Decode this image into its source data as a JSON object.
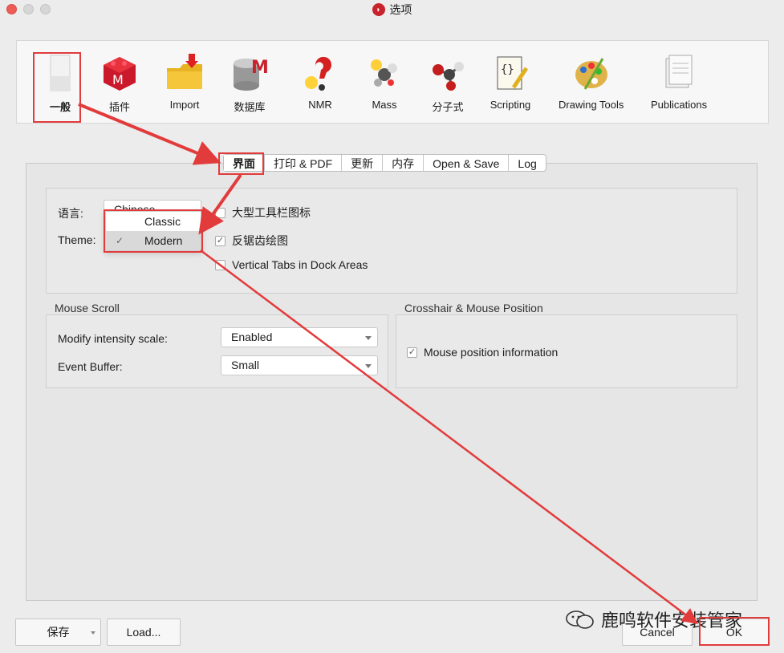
{
  "window": {
    "title": "选项"
  },
  "toolbar": {
    "items": [
      {
        "label": "一般",
        "icon": "general-settings-icon"
      },
      {
        "label": "插件",
        "icon": "plugins-icon"
      },
      {
        "label": "Import",
        "icon": "import-folder-icon"
      },
      {
        "label": "数据库",
        "icon": "database-icon"
      },
      {
        "label": "NMR",
        "icon": "nmr-icon"
      },
      {
        "label": "Mass",
        "icon": "mass-spec-icon"
      },
      {
        "label": "分子式",
        "icon": "molecule-icon"
      },
      {
        "label": "Scripting",
        "icon": "script-scroll-icon"
      },
      {
        "label": "Drawing Tools",
        "icon": "palette-icon"
      },
      {
        "label": "Publications",
        "icon": "publications-icon"
      }
    ]
  },
  "tabs": [
    "界面",
    "打印 & PDF",
    "更新",
    "内存",
    "Open & Save",
    "Log"
  ],
  "appearance": {
    "language_label": "语言:",
    "language_value": "Chinese",
    "theme_label": "Theme:",
    "theme_options": [
      "Classic",
      "Modern"
    ],
    "theme_selected": "Modern",
    "checkboxes": [
      {
        "label": "大型工具栏图标",
        "checked": false
      },
      {
        "label": "反锯齿绘图",
        "checked": true
      },
      {
        "label": "Vertical Tabs in Dock Areas",
        "checked": false
      }
    ]
  },
  "mouse_scroll": {
    "title": "Mouse Scroll",
    "intensity_label": "Modify intensity scale:",
    "intensity_value": "Enabled",
    "buffer_label": "Event Buffer:",
    "buffer_value": "Small"
  },
  "crosshair": {
    "title": "Crosshair & Mouse Position",
    "mouse_info_label": "Mouse position information",
    "mouse_info_checked": true
  },
  "buttons": {
    "save": "保存",
    "load": "Load...",
    "cancel": "Cancel",
    "ok": "OK"
  },
  "watermark": {
    "text": "鹿鸣软件安装管家"
  },
  "colors": {
    "highlight": "#e23b3b",
    "accent": "#c8232c"
  }
}
